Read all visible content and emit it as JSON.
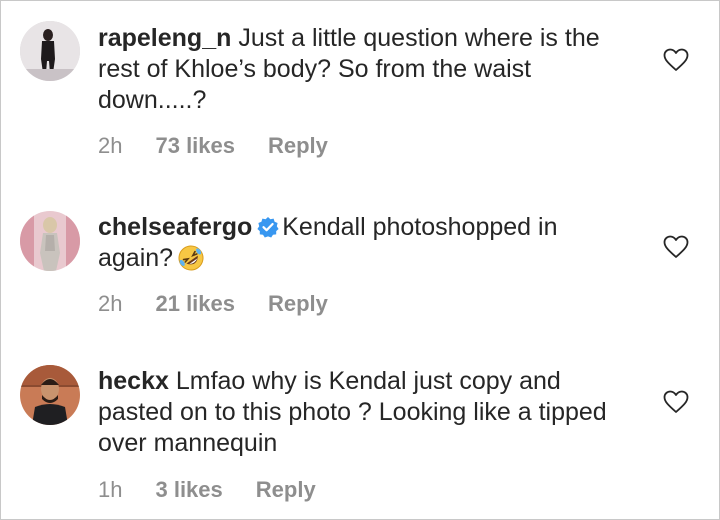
{
  "comments": [
    {
      "username": "rapeleng_n",
      "text": "Just a little question where is the rest of Khloe’s body? So from the waist down.....?",
      "verified": false,
      "time": "2h",
      "likes": "73 likes",
      "reply": "Reply",
      "avatar_icon": "person-photo-avatar"
    },
    {
      "username": "chelseafergo",
      "text": "Kendall photoshopped in again?",
      "verified": true,
      "emoji": "rolling-on-floor-laughing-emoji",
      "time": "2h",
      "likes": "21 likes",
      "reply": "Reply",
      "avatar_icon": "person-photo-avatar"
    },
    {
      "username": "heckx",
      "text": "Lmfao why is Kendal just copy and pasted on to this photo ? Looking like a tipped over mannequin",
      "verified": false,
      "time": "1h",
      "likes": "3 likes",
      "reply": "Reply",
      "avatar_icon": "person-photo-avatar"
    }
  ],
  "colors": {
    "text": "#262626",
    "meta": "#8e8e8e",
    "verified": "#3897f0"
  }
}
